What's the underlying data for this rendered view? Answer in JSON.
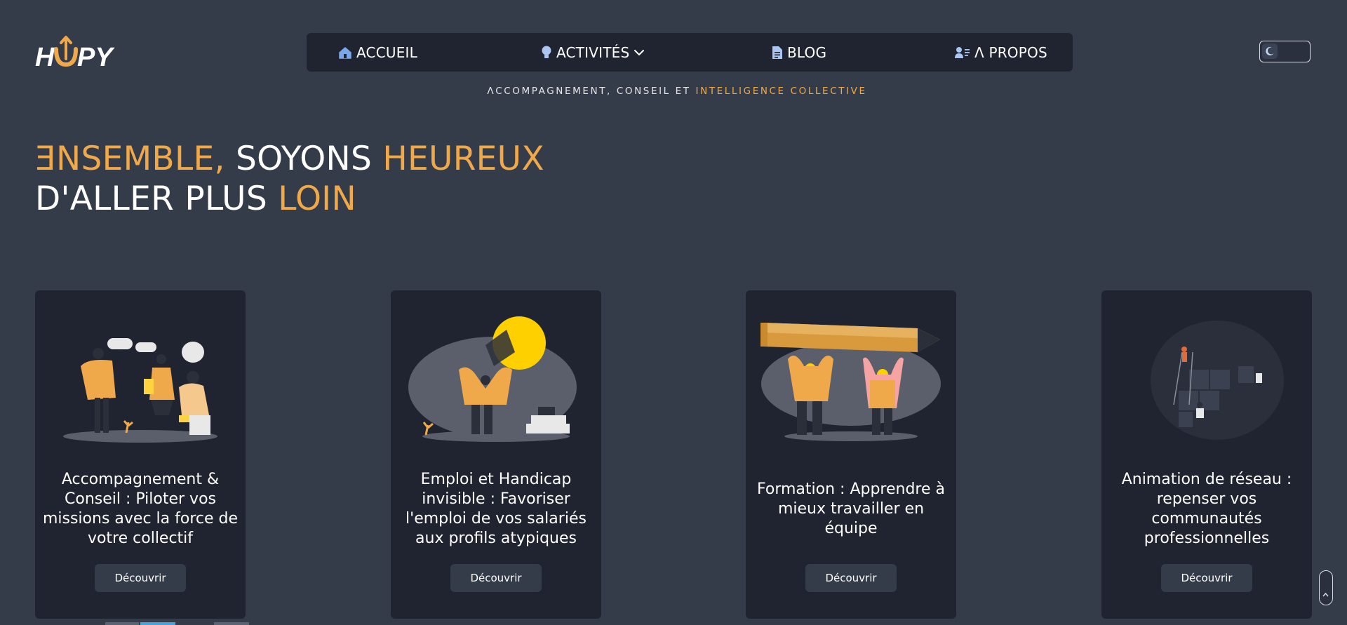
{
  "brand": {
    "logo_text": "HUPPY"
  },
  "nav": {
    "items": [
      {
        "label": "ACCUEIL",
        "icon": "home-icon"
      },
      {
        "label": "ACTIVITÉS",
        "icon": "lightbulb-icon",
        "dropdown_icon": "chevron-down-icon"
      },
      {
        "label": "BLOG",
        "icon": "document-icon"
      },
      {
        "label": "Λ PROPOS",
        "icon": "user-list-icon"
      }
    ]
  },
  "tagline": {
    "main": "ΛCCOMPAGNEMENT, CONSEIL ET ",
    "accent": "INTELLIGENCE COLLECTIVE"
  },
  "theme_toggle": {
    "icon": "moon-icon"
  },
  "hero": {
    "line1_accent": "ƎNSEMBLE,",
    "line1_main": " SOYONS ",
    "line1_accent2": "HEUREUX",
    "line2_main": "D'ALLER PLUS ",
    "line2_accent": "LOIN"
  },
  "cards": [
    {
      "title": "Accompagnement & Conseil : Piloter vos missions avec la force de votre collectif",
      "button": "Découvrir"
    },
    {
      "title": "Emploi et Handicap invisible : Favoriser l'emploi de vos salariés aux profils atypiques",
      "button": "Découvrir"
    },
    {
      "title": "Formation : Apprendre à mieux travailler en équipe",
      "button": "Découvrir"
    },
    {
      "title": "Animation de réseau : repenser vos communautés professionnelles",
      "button": "Découvrir"
    }
  ],
  "colors": {
    "background": "#343c4a",
    "panel": "#1f2430",
    "accent": "#f0a94a",
    "text": "#ffffff"
  }
}
